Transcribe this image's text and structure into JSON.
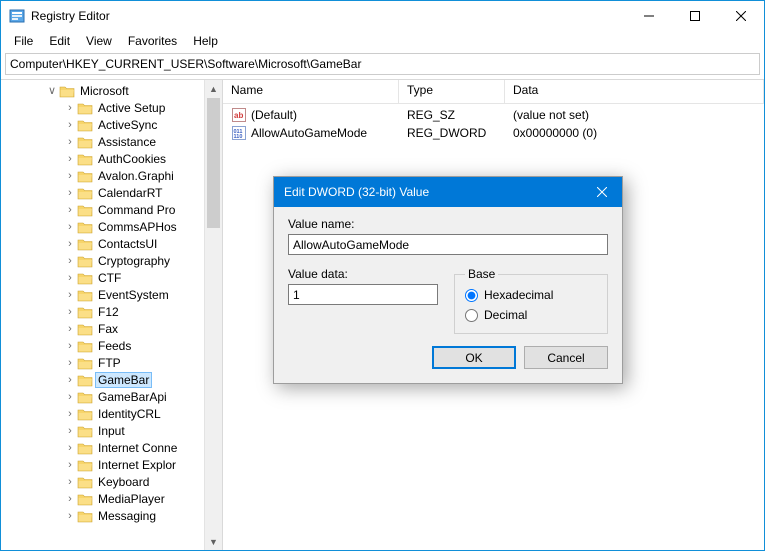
{
  "app": {
    "title": "Registry Editor"
  },
  "menu": {
    "items": [
      "File",
      "Edit",
      "View",
      "Favorites",
      "Help"
    ]
  },
  "address": "Computer\\HKEY_CURRENT_USER\\Software\\Microsoft\\GameBar",
  "tree": {
    "parent_label": "Microsoft",
    "selected": "GameBar",
    "items": [
      "Active Setup",
      "ActiveSync",
      "Assistance",
      "AuthCookies",
      "Avalon.Graphi",
      "CalendarRT",
      "Command Pro",
      "CommsAPHos",
      "ContactsUI",
      "Cryptography",
      "CTF",
      "EventSystem",
      "F12",
      "Fax",
      "Feeds",
      "FTP",
      "GameBar",
      "GameBarApi",
      "IdentityCRL",
      "Input",
      "Internet Conne",
      "Internet Explor",
      "Keyboard",
      "MediaPlayer",
      "Messaging"
    ]
  },
  "list": {
    "headers": {
      "name": "Name",
      "type": "Type",
      "data": "Data"
    },
    "rows": [
      {
        "icon": "sz",
        "name": "(Default)",
        "type": "REG_SZ",
        "data": "(value not set)"
      },
      {
        "icon": "dw",
        "name": "AllowAutoGameMode",
        "type": "REG_DWORD",
        "data": "0x00000000 (0)"
      }
    ]
  },
  "dialog": {
    "title": "Edit DWORD (32-bit) Value",
    "value_name_label": "Value name:",
    "value_name": "AllowAutoGameMode",
    "value_data_label": "Value data:",
    "value_data": "1",
    "base_label": "Base",
    "hex_label": "Hexadecimal",
    "dec_label": "Decimal",
    "base_selected": "hex",
    "ok": "OK",
    "cancel": "Cancel"
  }
}
